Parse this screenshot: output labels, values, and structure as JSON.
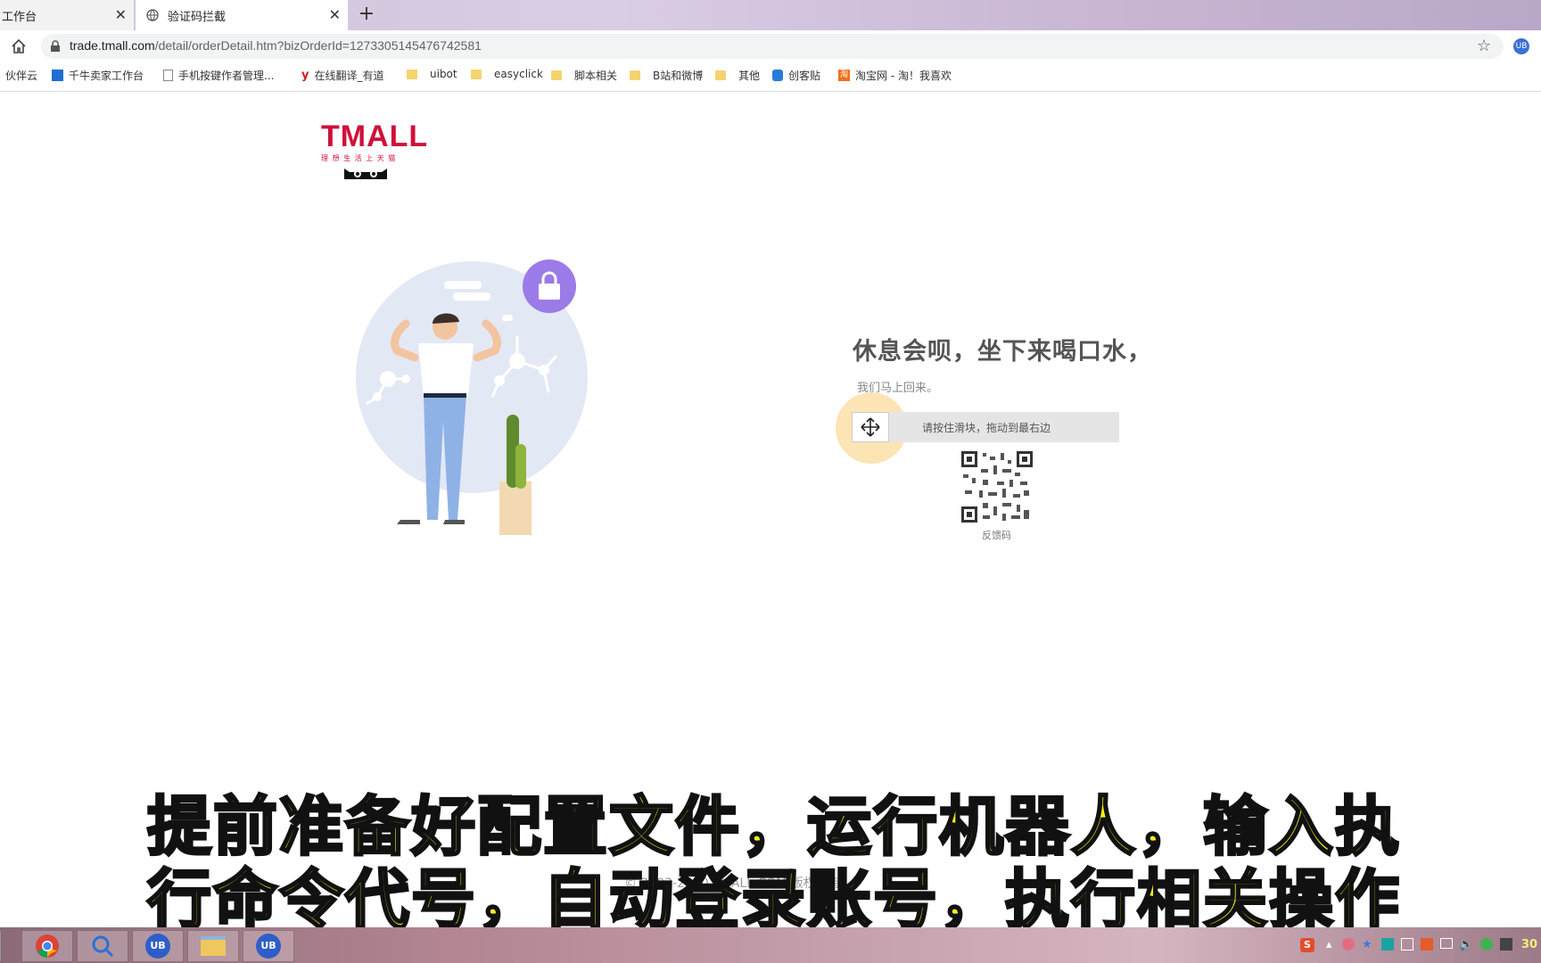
{
  "tabs": [
    {
      "title": "工作台"
    },
    {
      "title": "验证码拦截"
    }
  ],
  "address": {
    "host": "trade.tmall.com",
    "path": "/detail/orderDetail.htm?bizOrderId=1273305145476742581"
  },
  "bookmarks": [
    {
      "label": "伙伴云"
    },
    {
      "label": "千牛卖家工作台"
    },
    {
      "label": "手机按键作者管理..."
    },
    {
      "label": "在线翻译_有道"
    },
    {
      "label": "uibot"
    },
    {
      "label": "easyclick"
    },
    {
      "label": "脚本相关"
    },
    {
      "label": "B站和微博"
    },
    {
      "label": "其他"
    },
    {
      "label": "创客贴"
    },
    {
      "label": "淘宝网 - 淘！我喜欢"
    }
  ],
  "logo": {
    "text": "TMALL",
    "slogan": "理 想 生 活 上 天 猫"
  },
  "captcha": {
    "headline": "休息会呗，坐下来喝口水，",
    "subline": "我们马上回来。",
    "slider_hint": "请按住滑块，拖动到最右边",
    "qr_label": "反馈码"
  },
  "footer": "© 2003-2020 TMALL.COM 版权所有",
  "caption": {
    "line1": "提前准备好配置文件，运行机器人，输入执",
    "line2": "行命令代号，自动登录账号，执行相关操作"
  },
  "tray": {
    "time": "30"
  },
  "colors": {
    "tmall_red": "#d0103a",
    "lock_purple": "#9b7be8",
    "caption_yellow": "#f5ef19"
  }
}
